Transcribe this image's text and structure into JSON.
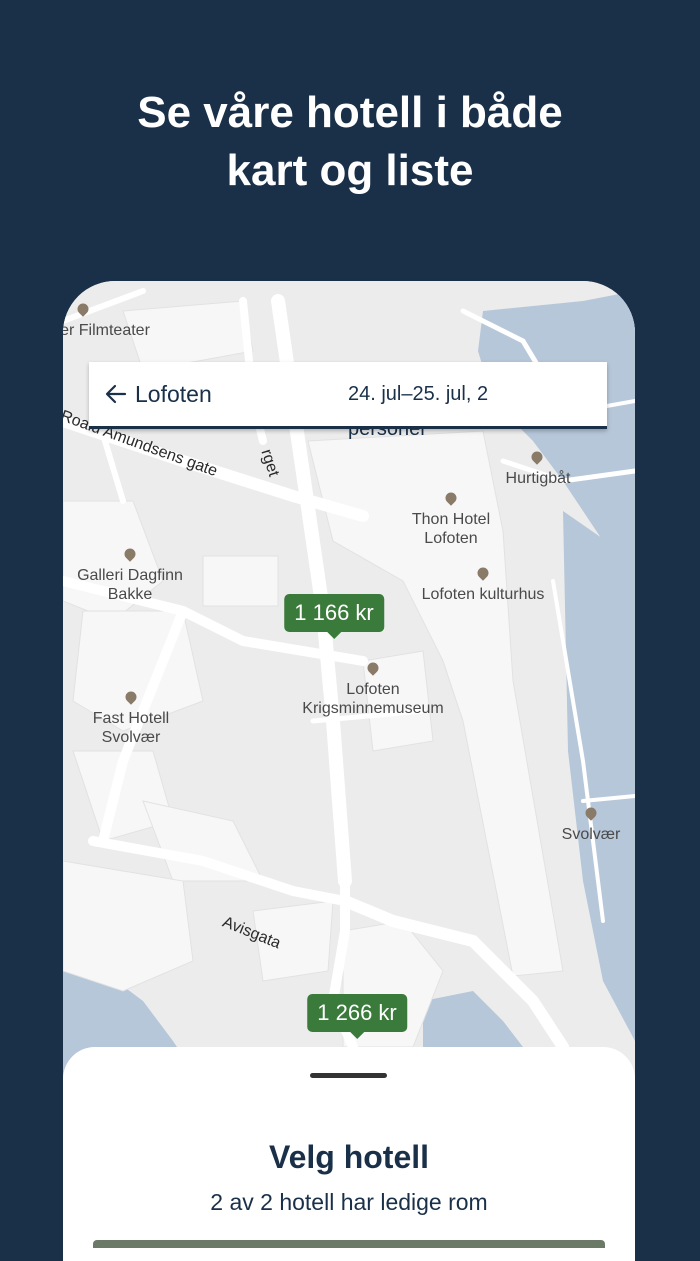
{
  "headline": {
    "line1": "Se våre hotell i både",
    "line2": "kart og liste"
  },
  "search": {
    "location": "Lofoten",
    "dates": "24. jul–25. jul, 2",
    "overflow": "personer"
  },
  "map": {
    "places": [
      {
        "name": "Filmteater",
        "text": "er Filmteater"
      },
      {
        "name": "Hurtigbat",
        "text": "Hurtigbåt"
      },
      {
        "name": "thon-hotel",
        "line1": "Thon Hotel",
        "line2": "Lofoten"
      },
      {
        "name": "galleri",
        "line1": "Galleri Dagfinn",
        "line2": "Bakke"
      },
      {
        "name": "kulturhus",
        "text": "Lofoten kulturhus"
      },
      {
        "name": "krigsminnemuseum",
        "line1": "Lofoten",
        "line2": "Krigsminnemuseum"
      },
      {
        "name": "fast-hotell",
        "line1": "Fast Hotell",
        "line2": "Svolvær"
      },
      {
        "name": "svolvaer",
        "text": "Svolvær"
      }
    ],
    "streets": {
      "amundsens": "Roald Amundsens gate",
      "torget": "rget",
      "avisgata": "Avisgata"
    },
    "prices": [
      "1 166 kr",
      "1 266 kr"
    ]
  },
  "sheet": {
    "title": "Velg hotell",
    "subtitle": "2 av 2 hotell har ledige rom"
  },
  "colors": {
    "background": "#1a3049",
    "price_marker": "#3a7a3a",
    "water": "#b6c7d9",
    "map_land": "#ececec"
  }
}
